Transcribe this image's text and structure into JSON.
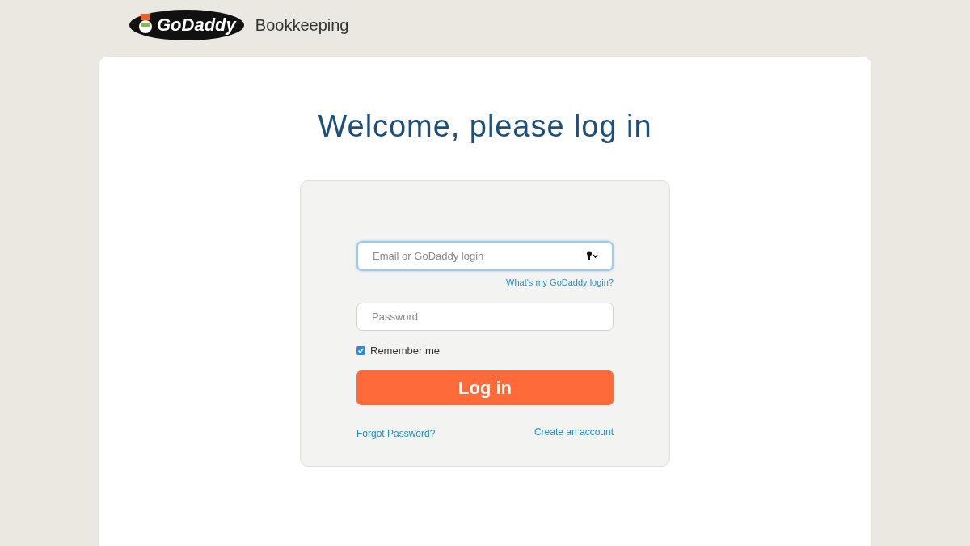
{
  "header": {
    "logo_text": "GoDaddy",
    "product": "Bookkeeping"
  },
  "title": "Welcome, please log in",
  "form": {
    "email": {
      "placeholder": "Email or GoDaddy login",
      "focused": true
    },
    "login_help_link": "What's my GoDaddy login?",
    "password": {
      "placeholder": "Password"
    },
    "remember": {
      "label": "Remember me",
      "checked": true
    },
    "submit": "Log in",
    "forgot_link": "Forgot Password?",
    "create_link": "Create an account"
  }
}
